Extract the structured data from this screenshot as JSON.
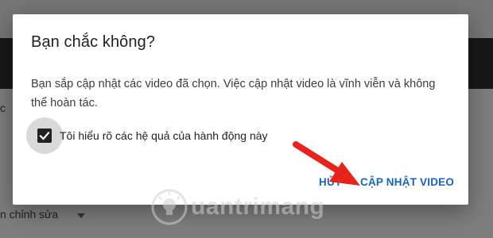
{
  "background": {
    "edit_label": "n chỉnh sửa",
    "left_fragment": "c"
  },
  "dialog": {
    "title": "Bạn chắc không?",
    "body": "Bạn sắp cập nhật các video đã chọn. Việc cập nhật video là vĩnh viễn và không thể hoàn tác.",
    "checkbox_label": "Tôi hiểu rõ các hệ quả của hành động này",
    "checkbox_checked": true,
    "cancel_label": "HỦY",
    "confirm_label": "CẬP NHẬT VIDEO"
  },
  "watermark": {
    "text": "uantrimang"
  },
  "colors": {
    "accent": "#1565c0",
    "annotation_arrow": "#e8231c",
    "checkbox": "#212121"
  },
  "icons": {
    "checkbox": "check-icon",
    "background_dropdown": "chevron-down-icon",
    "watermark_logo": "lightbulb-icon",
    "annotation": "red-arrow-icon"
  }
}
